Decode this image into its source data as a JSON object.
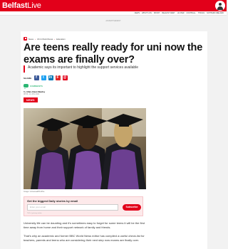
{
  "site": {
    "logo_main": "Belfast",
    "logo_live": "Live"
  },
  "nav": {
    "items": [
      "News",
      "What's On",
      "Sport",
      "Belfast Rest",
      "Ulster",
      "Football",
      "Things",
      "Nothern Ireland"
    ]
  },
  "ad_label": "Advertisement",
  "breadcrumbs": {
    "items": [
      "News",
      "UK & World News",
      "Education"
    ]
  },
  "article": {
    "headline": "Are teens really ready for uni now the exams are finally over?",
    "deck": "Academic says its important to highlight the support services available",
    "share_label": "SHARE",
    "comments_label": "COMMENTS",
    "byline_prefix": "By",
    "author": "Allan-Clean Mawley",
    "dateline": "08:30, 14 JUN 2021",
    "tag": "NEWS",
    "image_caption": "Image: Universal/PA Wire",
    "paragraphs": [
      "University life can be daunting and it's sometimes easy to forget for some teens it will be the first time away from home and their support network of family and friends.",
      "That's why an academic and former BBC World News editor has compiled a useful check-list for teachers, parents and teens who are considering their next step now exams are finally over.",
      ""
    ]
  },
  "newsletter": {
    "title": "Get the biggest Daily stories by email",
    "placeholder": "Enter your email",
    "button": "Subscribe",
    "fine_print": "T&Cs | privacy notice"
  },
  "share_icons": [
    {
      "name": "facebook-icon",
      "glyph": "f",
      "color": "#3b5998"
    },
    {
      "name": "twitter-icon",
      "glyph": "t",
      "color": "#1da1f2"
    },
    {
      "name": "linkedin-icon",
      "glyph": "in",
      "color": "#0077b5"
    },
    {
      "name": "flipboard-icon",
      "glyph": "F",
      "color": "#e12828"
    },
    {
      "name": "email-icon",
      "glyph": "@",
      "color": "#e2001a"
    }
  ],
  "colors": {
    "brand": "#e2001a",
    "comments": "#2bb673"
  }
}
